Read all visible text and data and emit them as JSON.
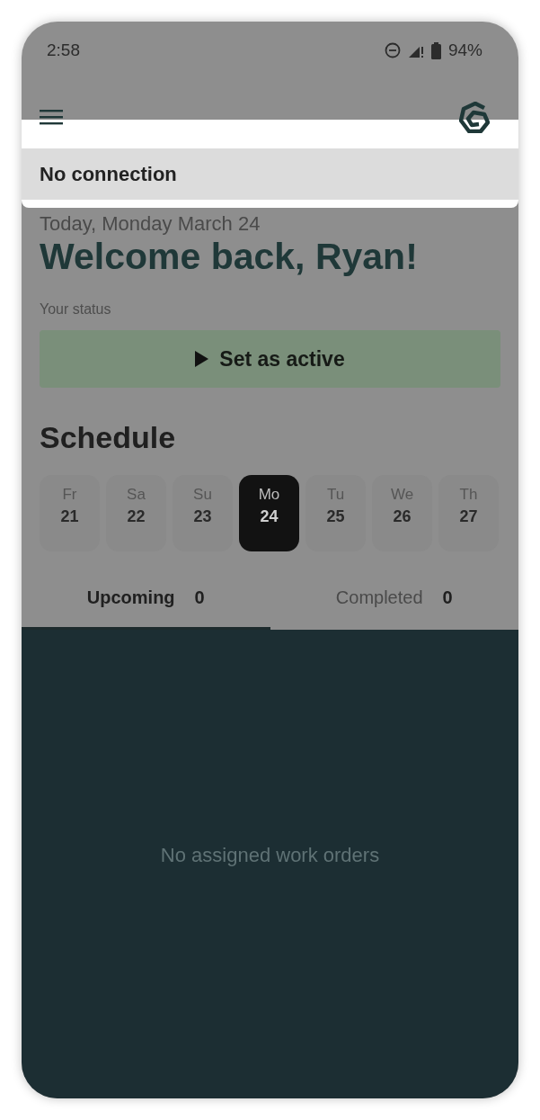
{
  "status_bar": {
    "time": "2:58",
    "battery": "94%"
  },
  "banner": {
    "message": "No connection"
  },
  "date": "Today, Monday March 24",
  "greeting": "Welcome back, Ryan!",
  "status": {
    "label": "Your status",
    "button": "Set as active"
  },
  "schedule": {
    "title": "Schedule",
    "days": [
      {
        "weekday": "Fr",
        "day": "21",
        "selected": false
      },
      {
        "weekday": "Sa",
        "day": "22",
        "selected": false
      },
      {
        "weekday": "Su",
        "day": "23",
        "selected": false
      },
      {
        "weekday": "Mo",
        "day": "24",
        "selected": true
      },
      {
        "weekday": "Tu",
        "day": "25",
        "selected": false
      },
      {
        "weekday": "We",
        "day": "26",
        "selected": false
      },
      {
        "weekday": "Th",
        "day": "27",
        "selected": false
      }
    ]
  },
  "tabs": [
    {
      "label": "Upcoming",
      "count": "0",
      "selected": true
    },
    {
      "label": "Completed",
      "count": "0",
      "selected": false
    }
  ],
  "empty_message": "No assigned work orders"
}
